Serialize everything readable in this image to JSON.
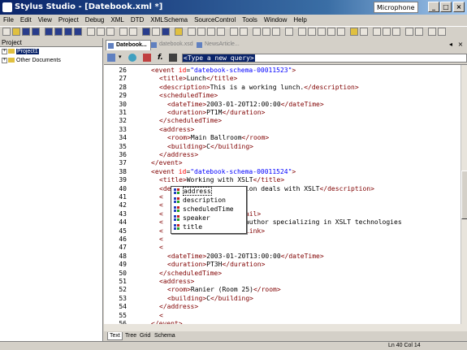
{
  "window": {
    "title": "Stylus Studio - [Datebook.xml *]",
    "input_indicator": "Microphone",
    "min": "_",
    "max": "□",
    "close": "×"
  },
  "menu": [
    "File",
    "Edit",
    "View",
    "Project",
    "Debug",
    "XML",
    "DTD",
    "XMLSchema",
    "SourceControl",
    "Tools",
    "Window",
    "Help"
  ],
  "project": {
    "header": "Project",
    "items": [
      {
        "expander": "+",
        "label": "Project1",
        "selected": true
      },
      {
        "expander": "+",
        "label": "Other Documents",
        "selected": false
      }
    ]
  },
  "tabs": [
    {
      "label": "Datebook...",
      "active": true
    },
    {
      "label": "datebook.xsd",
      "active": false
    },
    {
      "label": "NewsArticle...",
      "active": false
    }
  ],
  "query": {
    "placeholder": "<Type a new query>"
  },
  "code_lines": [
    {
      "n": "26",
      "indent": 3,
      "parts": [
        [
          "t",
          "<event "
        ],
        [
          "a",
          "id"
        ],
        [
          "x",
          "="
        ],
        [
          "v",
          "\"datebook-schema-00011523\""
        ],
        [
          "t",
          ">"
        ]
      ]
    },
    {
      "n": "27",
      "indent": 4,
      "parts": [
        [
          "t",
          "<title>"
        ],
        [
          "x",
          "Lunch"
        ],
        [
          "t",
          "</title>"
        ]
      ]
    },
    {
      "n": "28",
      "indent": 4,
      "parts": [
        [
          "t",
          "<description>"
        ],
        [
          "x",
          "This is a working lunch."
        ],
        [
          "t",
          "</description>"
        ]
      ]
    },
    {
      "n": "29",
      "indent": 4,
      "parts": [
        [
          "t",
          "<scheduledTime>"
        ]
      ]
    },
    {
      "n": "30",
      "indent": 5,
      "parts": [
        [
          "t",
          "<dateTime>"
        ],
        [
          "x",
          "2003-01-20T12:00:00"
        ],
        [
          "t",
          "</dateTime>"
        ]
      ]
    },
    {
      "n": "31",
      "indent": 5,
      "parts": [
        [
          "t",
          "<duration>"
        ],
        [
          "x",
          "PT1M"
        ],
        [
          "t",
          "</duration>"
        ]
      ]
    },
    {
      "n": "32",
      "indent": 4,
      "parts": [
        [
          "t",
          "</scheduledTime>"
        ]
      ]
    },
    {
      "n": "33",
      "indent": 4,
      "parts": [
        [
          "t",
          "<address>"
        ]
      ]
    },
    {
      "n": "34",
      "indent": 5,
      "parts": [
        [
          "t",
          "<room>"
        ],
        [
          "x",
          "Main Ballroom"
        ],
        [
          "t",
          "</room>"
        ]
      ]
    },
    {
      "n": "35",
      "indent": 5,
      "parts": [
        [
          "t",
          "<building>"
        ],
        [
          "x",
          "C"
        ],
        [
          "t",
          "</building>"
        ]
      ]
    },
    {
      "n": "36",
      "indent": 4,
      "parts": [
        [
          "t",
          "</address>"
        ]
      ]
    },
    {
      "n": "37",
      "indent": 3,
      "parts": [
        [
          "t",
          "</event>"
        ]
      ]
    },
    {
      "n": "38",
      "indent": 3,
      "parts": [
        [
          "t",
          "<event "
        ],
        [
          "a",
          "id"
        ],
        [
          "x",
          "="
        ],
        [
          "v",
          "\"datebook-schema-00011524\""
        ],
        [
          "t",
          ">"
        ]
      ]
    },
    {
      "n": "39",
      "indent": 4,
      "parts": [
        [
          "t",
          "<title>"
        ],
        [
          "x",
          "Working with XSLT"
        ],
        [
          "t",
          "</title>"
        ]
      ]
    },
    {
      "n": "40",
      "indent": 4,
      "parts": [
        [
          "t",
          "<description>"
        ],
        [
          "x",
          "This session deals with XSLT"
        ],
        [
          "t",
          "</description>"
        ]
      ]
    },
    {
      "n": "41",
      "indent": 4,
      "parts": [
        [
          "t",
          "<"
        ]
      ]
    },
    {
      "n": "42",
      "indent": 4,
      "parts": [
        [
          "t",
          "<"
        ],
        [
          "x",
          "        ean"
        ],
        [
          "t",
          "</name>"
        ]
      ]
    },
    {
      "n": "43",
      "indent": 4,
      "parts": [
        [
          "t",
          "<"
        ],
        [
          "x",
          "        sonic.com"
        ],
        [
          "t",
          "</email>"
        ]
      ]
    },
    {
      "n": "44",
      "indent": 4,
      "parts": [
        [
          "t",
          "<"
        ],
        [
          "x",
          "        llison is an author specializing in XSLT technologies"
        ]
      ]
    },
    {
      "n": "45",
      "indent": 4,
      "parts": [
        [
          "t",
          "<"
        ],
        [
          "x",
          "        w.sonic.com"
        ],
        [
          "t",
          "</link>"
        ]
      ]
    },
    {
      "n": "46",
      "indent": 4,
      "parts": [
        [
          "t",
          "<"
        ]
      ]
    },
    {
      "n": "47",
      "indent": 4,
      "parts": [
        [
          "t",
          "<"
        ]
      ]
    },
    {
      "n": "48",
      "indent": 5,
      "parts": [
        [
          "t",
          "<dateTime>"
        ],
        [
          "x",
          "2003-01-20T13:00:00"
        ],
        [
          "t",
          "</dateTime>"
        ]
      ]
    },
    {
      "n": "49",
      "indent": 5,
      "parts": [
        [
          "t",
          "<duration>"
        ],
        [
          "x",
          "PT3H"
        ],
        [
          "t",
          "</duration>"
        ]
      ]
    },
    {
      "n": "50",
      "indent": 4,
      "parts": [
        [
          "t",
          "</scheduledTime>"
        ]
      ]
    },
    {
      "n": "51",
      "indent": 4,
      "parts": [
        [
          "t",
          "<address>"
        ]
      ]
    },
    {
      "n": "52",
      "indent": 5,
      "parts": [
        [
          "t",
          "<room>"
        ],
        [
          "x",
          "Ranier (Room 25)"
        ],
        [
          "t",
          "</room>"
        ]
      ]
    },
    {
      "n": "53",
      "indent": 5,
      "parts": [
        [
          "t",
          "<building>"
        ],
        [
          "x",
          "C"
        ],
        [
          "t",
          "</building>"
        ]
      ]
    },
    {
      "n": "54",
      "indent": 4,
      "parts": [
        [
          "t",
          "</address>"
        ]
      ]
    },
    {
      "n": "55",
      "indent": 4,
      "parts": [
        [
          "t",
          "<"
        ]
      ]
    },
    {
      "n": "56",
      "indent": 3,
      "parts": [
        [
          "t",
          "</event>"
        ]
      ]
    },
    {
      "n": "57",
      "indent": 2,
      "parts": [
        [
          "t",
          "</schedule>"
        ]
      ]
    },
    {
      "n": "58",
      "indent": 1,
      "parts": [
        [
          "t",
          "</datebook>"
        ]
      ]
    }
  ],
  "autocomplete": {
    "items": [
      "address",
      "description",
      "scheduledTime",
      "speaker",
      "title"
    ],
    "selected_index": 0
  },
  "view_tabs": [
    {
      "label": "Text",
      "active": true
    },
    {
      "label": "Tree",
      "active": false
    },
    {
      "label": "Grid",
      "active": false
    },
    {
      "label": "Schema",
      "active": false
    }
  ],
  "status": {
    "position": "Ln 40 Col 14"
  },
  "colors": {
    "tag": "#800000",
    "attr": "#ff0000",
    "value": "#0000ff",
    "text": "#000000",
    "title_bar": "#0a246a"
  }
}
